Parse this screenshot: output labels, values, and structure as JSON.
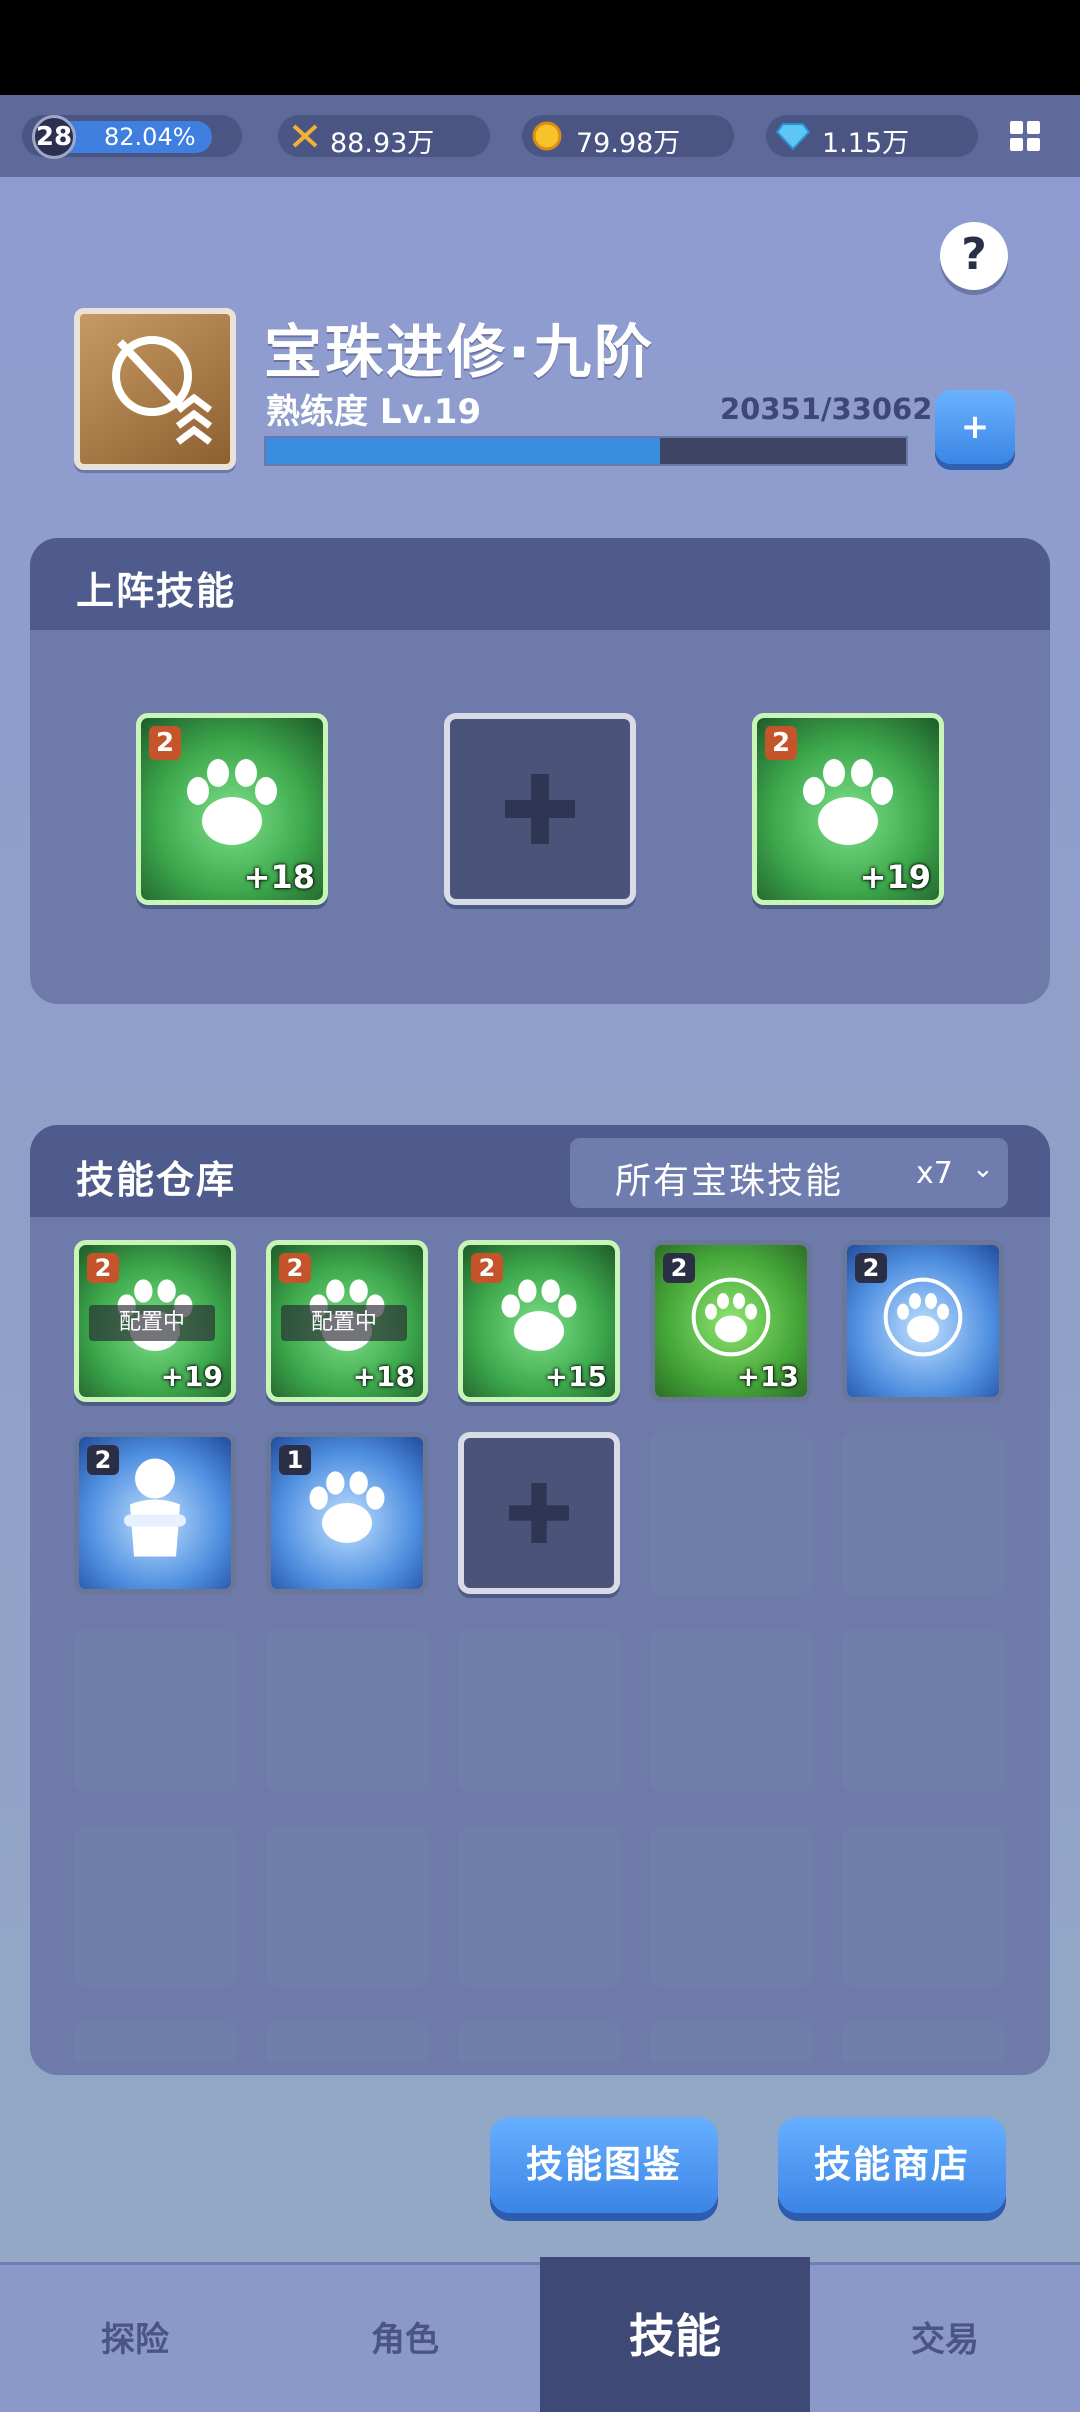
{
  "topbar": {
    "level": "28",
    "exp_percent_label": "82.04%",
    "power": "88.93万",
    "gold": "79.98万",
    "diamonds": "1.15万"
  },
  "skill": {
    "title": "宝珠进修·九阶",
    "proficiency": "熟练度 Lv.19",
    "exp_text": "20351/33062",
    "exp_fraction": 0.6155,
    "plus_label": "+",
    "help_label": "?"
  },
  "equipped_panel": {
    "title": "上阵技能",
    "slots": [
      {
        "type": "skill",
        "badge": "2",
        "bonus": "+18"
      },
      {
        "type": "add"
      },
      {
        "type": "skill",
        "badge": "2",
        "bonus": "+19"
      }
    ]
  },
  "warehouse": {
    "title": "技能仓库",
    "filter_label": "所有宝珠技能",
    "filter_count": "x7",
    "equipped_tag": "配置中",
    "items": [
      {
        "badge": "2",
        "bonus": "+19",
        "equipped": true
      },
      {
        "badge": "2",
        "bonus": "+18",
        "equipped": true
      },
      {
        "badge": "2",
        "bonus": "+15",
        "equipped": false
      },
      {
        "badge": "2",
        "bonus": "+13",
        "equipped": false
      },
      {
        "badge": "2",
        "bonus": "",
        "equipped": false
      },
      {
        "badge": "2",
        "bonus": "",
        "equipped": false
      },
      {
        "badge": "1",
        "bonus": "",
        "equipped": false
      }
    ]
  },
  "buttons": {
    "codex": "技能图鉴",
    "shop": "技能商店"
  },
  "nav": {
    "explore": "探险",
    "character": "角色",
    "skills": "技能",
    "trade": "交易"
  }
}
